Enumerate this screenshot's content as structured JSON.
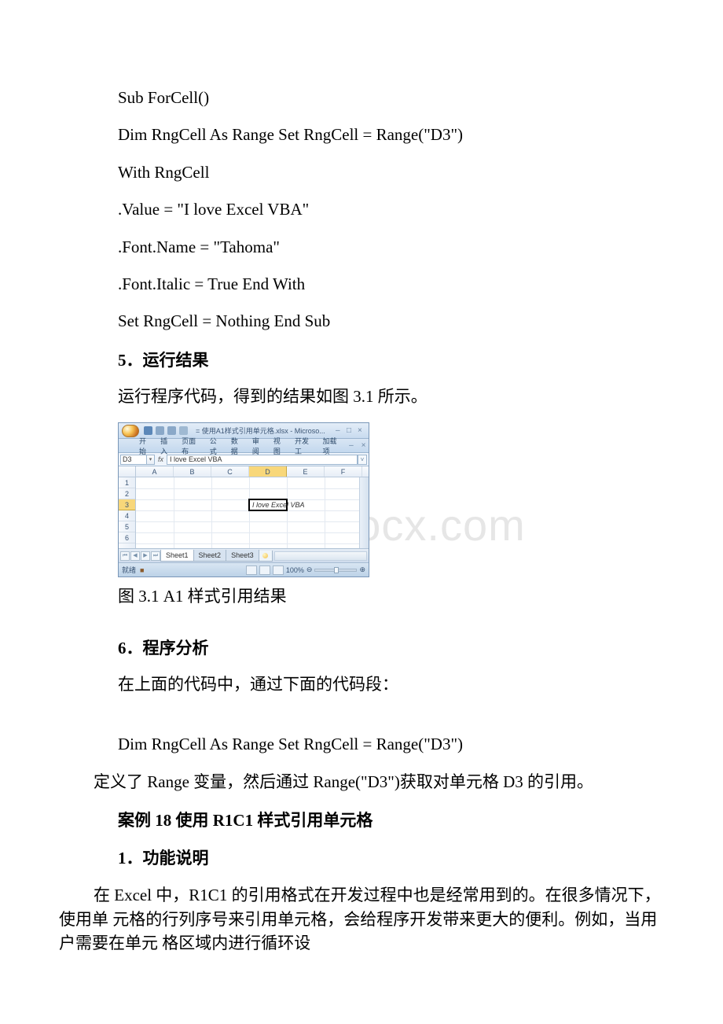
{
  "code": {
    "l1": "Sub ForCell()",
    "l2": "Dim RngCell As Range  Set RngCell = Range(\"D3\")",
    "l3": "With RngCell",
    "l4": ".Value = \"I love Excel VBA\"",
    "l5": ".Font.Name = \"Tahoma\"",
    "l6": ".Font.Italic = True End With",
    "l7": "Set RngCell = Nothing End Sub"
  },
  "sec5": {
    "heading": "5．运行结果",
    "text": "运行程序代码，得到的结果如图 3.1 所示。"
  },
  "figure": {
    "caption": "图 3.1  A1 样式引用结果"
  },
  "watermark": "www.bdocx.com",
  "sec6": {
    "heading": "6．程序分析",
    "intro": "在上面的代码中，通过下面的代码段：",
    "snippet": "Dim RngCell As Range  Set RngCell = Range(\"D3\")",
    "explain": "定义了 Range 变量，然后通过 Range(\"D3\")获取对单元格 D3 的引用。"
  },
  "case18": {
    "title": "案例 18 使用 R1C1 样式引用单元格",
    "sec1_heading": "1．功能说明",
    "sec1_body": "在 Excel 中，R1C1 的引用格式在开发过程中也是经常用到的。在很多情况下，使用单 元格的行列序号来引用单元格，会给程序开发带来更大的便利。例如，当用户需要在单元 格区域内进行循环设"
  },
  "excel": {
    "title": "使用A1样式引用单元格.xlsx - Microso...",
    "tabs": [
      "开始",
      "插入",
      "页面布",
      "公式",
      "数据",
      "审阅",
      "视图",
      "开发工",
      "加载项"
    ],
    "name_box": "D3",
    "formula": "I love Excel VBA",
    "cell_value": "I love Excel VBA",
    "columns": [
      "A",
      "B",
      "C",
      "D",
      "E",
      "F"
    ],
    "rows": [
      "1",
      "2",
      "3",
      "4",
      "5",
      "6"
    ],
    "sheets": [
      "Sheet1",
      "Sheet2",
      "Sheet3"
    ],
    "status": "就绪",
    "zoom": "100%",
    "macro_hint": "■"
  }
}
